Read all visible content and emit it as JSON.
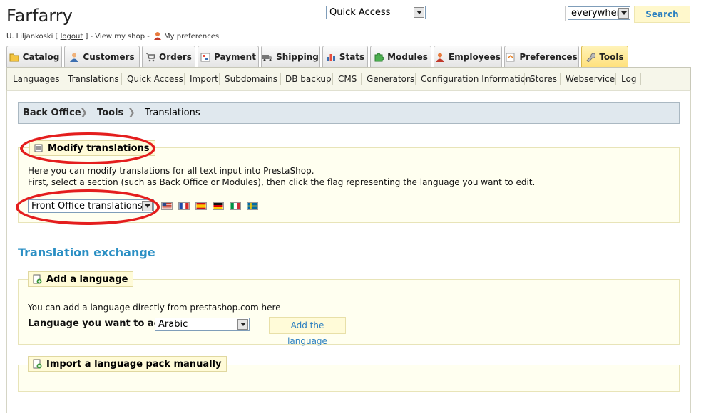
{
  "header": {
    "shop_title": "Farfarry",
    "user_prefix": "U. Liljankoski [ ",
    "logout_label": "logout",
    "user_suffix": " ] - View my shop - ",
    "preferences_label": "My preferences",
    "quick_access": "Quick Access",
    "search_value": "",
    "search_scope": "everywhere",
    "search_button": "Search"
  },
  "tabs": [
    {
      "label": "Catalog",
      "icon": "folder-icon"
    },
    {
      "label": "Customers",
      "icon": "customer-icon"
    },
    {
      "label": "Orders",
      "icon": "cart-icon"
    },
    {
      "label": "Payment",
      "icon": "payment-icon"
    },
    {
      "label": "Shipping",
      "icon": "truck-icon"
    },
    {
      "label": "Stats",
      "icon": "stats-icon"
    },
    {
      "label": "Modules",
      "icon": "puzzle-icon"
    },
    {
      "label": "Employees",
      "icon": "employee-icon"
    },
    {
      "label": "Preferences",
      "icon": "preferences-icon"
    },
    {
      "label": "Tools",
      "icon": "wrench-icon",
      "active": true
    }
  ],
  "subnav": [
    "Languages",
    "Translations",
    "Quick Access",
    "Import",
    "Subdomains",
    "DB backup",
    "CMS",
    "Generators",
    "Configuration Information",
    "Stores",
    "Webservice",
    "Log"
  ],
  "breadcrumb": {
    "root": "Back Office",
    "parent": "Tools",
    "current": "Translations"
  },
  "modify": {
    "legend": "Modify translations",
    "line1": "Here you can modify translations for all text input into PrestaShop.",
    "line2": "First, select a section (such as Back Office or Modules), then click the flag representing the language you want to edit.",
    "section_select": "Front Office translations",
    "flags": [
      "en-flag-icon",
      "fr-flag-icon",
      "es-flag-icon",
      "de-flag-icon",
      "it-flag-icon",
      "sv-flag-icon"
    ]
  },
  "exchange": {
    "heading": "Translation exchange",
    "add_legend": "Add a language",
    "add_text": "You can add a language directly from prestashop.com here",
    "add_label": "Language you want to add:",
    "add_select": "Arabic",
    "add_button": "Add the language",
    "import_legend": "Import a language pack manually"
  },
  "colors": {
    "accent_blue": "#2b8fc4",
    "highlight_red": "#e41e1e",
    "tab_active": "#ffe07a",
    "panel_bg": "#fffff0"
  }
}
